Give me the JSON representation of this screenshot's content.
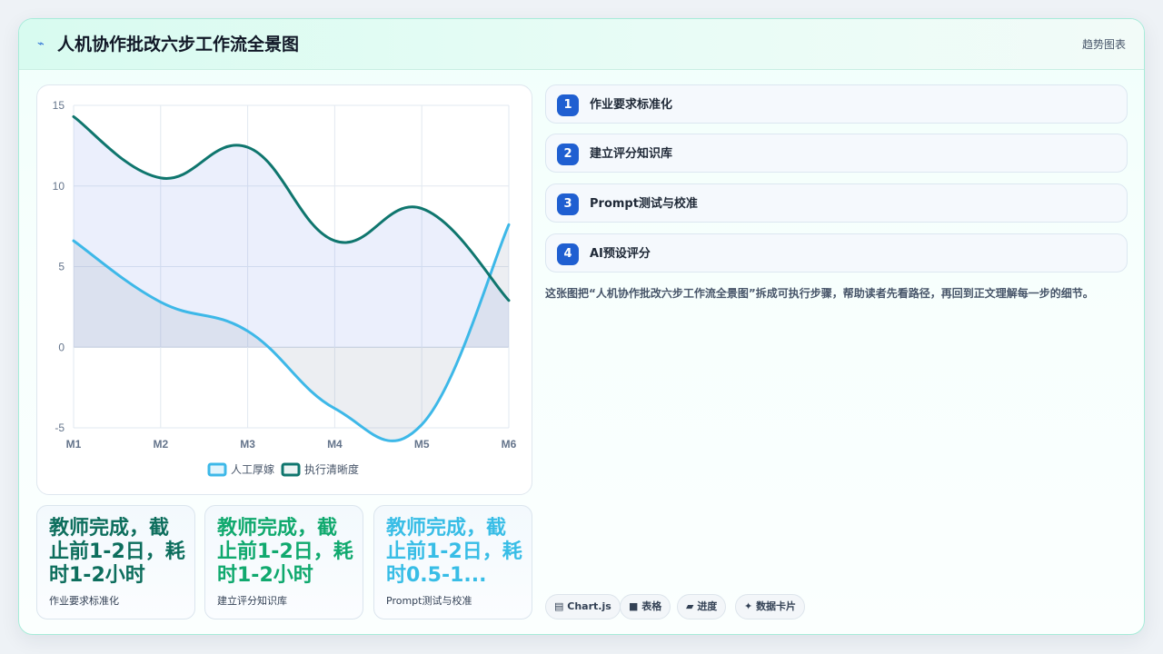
{
  "header": {
    "title_icon": "bolt-icon",
    "title": "人机协作批改六步工作流全景图",
    "tag": "趋势图表"
  },
  "chart_data": {
    "type": "line",
    "categories": [
      "M1",
      "M2",
      "M3",
      "M4",
      "M5",
      "M6"
    ],
    "series": [
      {
        "name": "人工厚嫁",
        "values": [
          6.6,
          2.8,
          1.0,
          -3.8,
          -4.8,
          7.6
        ],
        "color": "#3db8e8",
        "fill": "rgba(148,163,184,0.18)"
      },
      {
        "name": "执行清晰度",
        "values": [
          14.3,
          10.5,
          12.4,
          6.6,
          8.6,
          2.9
        ],
        "color": "#0f766e",
        "fill": "rgba(99,133,230,0.13)"
      }
    ],
    "ylim": [
      -5,
      15
    ],
    "yticks": [
      15,
      10,
      5,
      0,
      -5
    ],
    "grid": true,
    "legend": "bottom"
  },
  "stats": [
    {
      "value": "教师完成，截止前1-2日，耗时1-2小时",
      "label": "作业要求标准化",
      "color": "#0d6e5d"
    },
    {
      "value": "教师完成，截止前1-2日，耗时1-2小时",
      "label": "建立评分知识库",
      "color": "#10a96e"
    },
    {
      "value": "教师完成，截止前1-2日，耗时0.5-1...",
      "label": "Prompt测试与校准",
      "color": "#38bde6"
    }
  ],
  "steps": [
    {
      "num": "1",
      "label": "作业要求标准化"
    },
    {
      "num": "2",
      "label": "建立评分知识库"
    },
    {
      "num": "3",
      "label": "Prompt测试与校准"
    },
    {
      "num": "4",
      "label": "AI预设评分"
    }
  ],
  "description": "这张图把“人机协作批改六步工作流全景图”拆成可执行步骤，帮助读者先看路径，再回到正文理解每一步的细节。",
  "chips": [
    {
      "icon": "chart-icon",
      "glyph": "▤",
      "label": "Chart.js"
    },
    {
      "icon": "table-icon",
      "glyph": "■",
      "label": "表格"
    },
    {
      "icon": "progress-icon",
      "glyph": "▰",
      "label": "进度"
    },
    {
      "icon": "sparkle-icon",
      "glyph": "✦",
      "label": "数据卡片"
    }
  ]
}
